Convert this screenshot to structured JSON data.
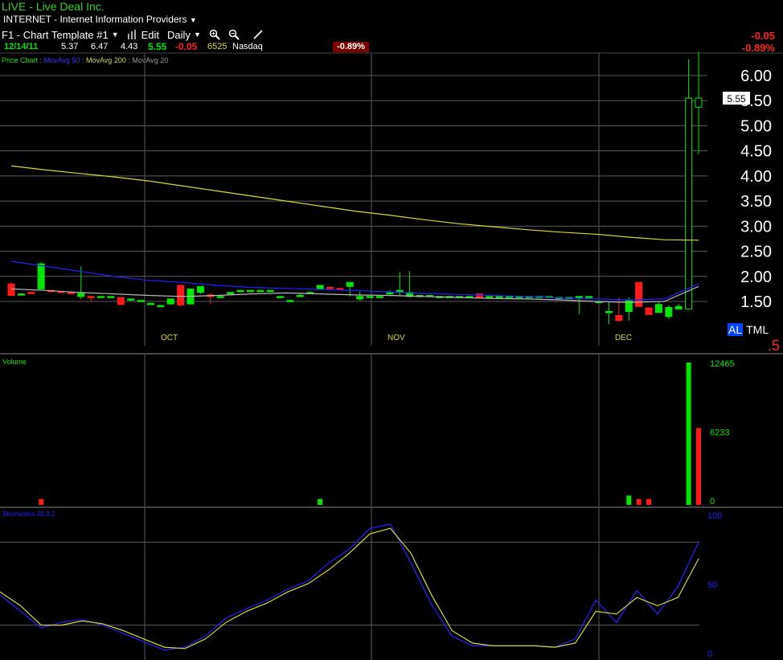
{
  "header": {
    "symbol": "LIVE",
    "separator": " - ",
    "company": "Live Deal Inc.",
    "sector_code": "INTERNET",
    "sector_name": "Internet Information Providers"
  },
  "toolbar": {
    "template_label": "F1 - Chart Template #1",
    "edit_label": "Edit",
    "period_label": "Daily"
  },
  "quote": {
    "date": "12/14/11",
    "open": "5.37",
    "high": "6.47",
    "low": "4.43",
    "close": "5.55",
    "change": "-0.05",
    "volume": "6525",
    "exchange": "Nasdaq",
    "pct_change": "-0.89%",
    "change_top": "-0.05",
    "pct_top": "-0.89%"
  },
  "indicators": {
    "price_chart": "Price Chart",
    "ma50": "MovAvg 50",
    "ma200": "MovAvg 200",
    "ma20": "MovAvg 20",
    "volume": "Volume",
    "stochastics": "Stochastics 20,3,2"
  },
  "side_tabs": {
    "tab1": "AL",
    "tab2": "TML",
    "partial": ".5"
  },
  "colors": {
    "up": "#00e600",
    "down": "#ff1a1a",
    "ma50": "#2222ff",
    "ma200": "#d8d830",
    "ma20": "#b8b8b8",
    "grid": "#5a5a5a"
  },
  "chart_data": [
    {
      "type": "candlestick",
      "title": "Price Chart",
      "y_ticks": [
        "1.50",
        "2.00",
        "2.50",
        "3.00",
        "3.50",
        "4.00",
        "4.50",
        "5.00",
        "5.50",
        "6.00"
      ],
      "ylim": [
        1.0,
        6.3
      ],
      "x_labels": [
        "OCT",
        "NOV",
        "DEC"
      ],
      "last_price_label": "5.55",
      "series": [
        {
          "name": "MovAvg 200",
          "values": [
            4.2,
            4.12,
            4.05,
            3.98,
            3.9,
            3.8,
            3.7,
            3.6,
            3.5,
            3.4,
            3.3,
            3.22,
            3.13,
            3.05,
            2.99,
            2.93,
            2.88,
            2.84,
            2.78,
            2.73,
            2.72
          ]
        },
        {
          "name": "MovAvg 50",
          "values": [
            2.3,
            2.2,
            2.1,
            2.0,
            1.92,
            1.88,
            1.82,
            1.78,
            1.76,
            1.74,
            1.72,
            1.69,
            1.66,
            1.64,
            1.62,
            1.6,
            1.57,
            1.55,
            1.53,
            1.55,
            1.85
          ]
        },
        {
          "name": "MovAvg 20",
          "values": [
            1.75,
            1.72,
            1.68,
            1.65,
            1.62,
            1.6,
            1.62,
            1.65,
            1.67,
            1.65,
            1.63,
            1.62,
            1.6,
            1.58,
            1.56,
            1.55,
            1.53,
            1.5,
            1.48,
            1.5,
            1.8
          ]
        }
      ],
      "candles": [
        {
          "o": 1.85,
          "h": 1.88,
          "l": 1.62,
          "c": 1.62
        },
        {
          "o": 1.65,
          "h": 1.66,
          "l": 1.64,
          "c": 1.65
        },
        {
          "o": 1.68,
          "h": 1.7,
          "l": 1.66,
          "c": 1.67
        },
        {
          "o": 1.75,
          "h": 2.28,
          "l": 1.72,
          "c": 2.25
        },
        {
          "o": 1.72,
          "h": 1.72,
          "l": 1.68,
          "c": 1.7
        },
        {
          "o": 1.7,
          "h": 1.7,
          "l": 1.66,
          "c": 1.68
        },
        {
          "o": 1.68,
          "h": 1.7,
          "l": 1.64,
          "c": 1.66
        },
        {
          "o": 1.6,
          "h": 2.2,
          "l": 1.55,
          "c": 1.66
        },
        {
          "o": 1.6,
          "h": 1.62,
          "l": 1.5,
          "c": 1.58
        },
        {
          "o": 1.6,
          "h": 1.6,
          "l": 1.58,
          "c": 1.6
        },
        {
          "o": 1.6,
          "h": 1.6,
          "l": 1.58,
          "c": 1.6
        },
        {
          "o": 1.58,
          "h": 1.58,
          "l": 1.44,
          "c": 1.44
        },
        {
          "o": 1.53,
          "h": 1.56,
          "l": 1.5,
          "c": 1.55
        },
        {
          "o": 1.52,
          "h": 1.53,
          "l": 1.5,
          "c": 1.52
        },
        {
          "o": 1.45,
          "h": 1.48,
          "l": 1.45,
          "c": 1.46
        },
        {
          "o": 1.42,
          "h": 1.43,
          "l": 1.4,
          "c": 1.42
        },
        {
          "o": 1.45,
          "h": 1.48,
          "l": 1.45,
          "c": 1.55
        },
        {
          "o": 1.82,
          "h": 1.84,
          "l": 1.4,
          "c": 1.43
        },
        {
          "o": 1.45,
          "h": 1.75,
          "l": 1.45,
          "c": 1.75
        },
        {
          "o": 1.68,
          "h": 1.8,
          "l": 1.65,
          "c": 1.8
        },
        {
          "o": 1.63,
          "h": 1.67,
          "l": 1.45,
          "c": 1.6
        },
        {
          "o": 1.6,
          "h": 1.62,
          "l": 1.58,
          "c": 1.6
        },
        {
          "o": 1.65,
          "h": 1.68,
          "l": 1.63,
          "c": 1.68
        },
        {
          "o": 1.7,
          "h": 1.72,
          "l": 1.68,
          "c": 1.72
        },
        {
          "o": 1.72,
          "h": 1.72,
          "l": 1.72,
          "c": 1.72
        },
        {
          "o": 1.72,
          "h": 1.72,
          "l": 1.72,
          "c": 1.72
        },
        {
          "o": 1.72,
          "h": 1.72,
          "l": 1.72,
          "c": 1.72
        },
        {
          "o": 1.6,
          "h": 1.6,
          "l": 1.58,
          "c": 1.6
        },
        {
          "o": 1.52,
          "h": 1.53,
          "l": 1.5,
          "c": 1.52
        },
        {
          "o": 1.62,
          "h": 1.65,
          "l": 1.6,
          "c": 1.62
        },
        {
          "o": 1.68,
          "h": 1.7,
          "l": 1.65,
          "c": 1.68
        },
        {
          "o": 1.75,
          "h": 1.82,
          "l": 1.73,
          "c": 1.82
        },
        {
          "o": 1.78,
          "h": 1.8,
          "l": 1.76,
          "c": 1.77
        },
        {
          "o": 1.76,
          "h": 1.76,
          "l": 1.74,
          "c": 1.75
        },
        {
          "o": 1.8,
          "h": 1.88,
          "l": 1.6,
          "c": 1.88
        },
        {
          "o": 1.55,
          "h": 1.7,
          "l": 1.52,
          "c": 1.6
        },
        {
          "o": 1.6,
          "h": 1.6,
          "l": 1.58,
          "c": 1.6
        },
        {
          "o": 1.6,
          "h": 1.6,
          "l": 1.58,
          "c": 1.6
        },
        {
          "o": 1.65,
          "h": 1.72,
          "l": 1.6,
          "c": 1.68
        },
        {
          "o": 1.68,
          "h": 2.08,
          "l": 1.62,
          "c": 1.72
        },
        {
          "o": 1.6,
          "h": 2.1,
          "l": 1.58,
          "c": 1.68
        },
        {
          "o": 1.62,
          "h": 1.62,
          "l": 1.6,
          "c": 1.62
        },
        {
          "o": 1.62,
          "h": 1.62,
          "l": 1.6,
          "c": 1.62
        },
        {
          "o": 1.6,
          "h": 1.6,
          "l": 1.6,
          "c": 1.6
        },
        {
          "o": 1.6,
          "h": 1.6,
          "l": 1.6,
          "c": 1.6
        },
        {
          "o": 1.6,
          "h": 1.6,
          "l": 1.6,
          "c": 1.6
        },
        {
          "o": 1.6,
          "h": 1.6,
          "l": 1.6,
          "c": 1.6
        },
        {
          "o": 1.65,
          "h": 1.65,
          "l": 1.58,
          "c": 1.58
        },
        {
          "o": 1.6,
          "h": 1.6,
          "l": 1.6,
          "c": 1.6
        },
        {
          "o": 1.6,
          "h": 1.6,
          "l": 1.6,
          "c": 1.6
        },
        {
          "o": 1.6,
          "h": 1.6,
          "l": 1.6,
          "c": 1.6
        },
        {
          "o": 1.6,
          "h": 1.6,
          "l": 1.6,
          "c": 1.6
        },
        {
          "o": 1.6,
          "h": 1.6,
          "l": 1.6,
          "c": 1.6
        },
        {
          "o": 1.6,
          "h": 1.6,
          "l": 1.6,
          "c": 1.6
        },
        {
          "o": 1.6,
          "h": 1.6,
          "l": 1.6,
          "c": 1.6
        },
        {
          "o": 1.58,
          "h": 1.58,
          "l": 1.58,
          "c": 1.58
        },
        {
          "o": 1.58,
          "h": 1.58,
          "l": 1.58,
          "c": 1.58
        },
        {
          "o": 1.6,
          "h": 1.6,
          "l": 1.25,
          "c": 1.6
        },
        {
          "o": 1.6,
          "h": 1.6,
          "l": 1.6,
          "c": 1.6
        },
        {
          "o": 1.5,
          "h": 1.5,
          "l": 1.48,
          "c": 1.5
        },
        {
          "o": 1.3,
          "h": 1.48,
          "l": 1.05,
          "c": 1.3
        },
        {
          "o": 1.22,
          "h": 1.58,
          "l": 1.1,
          "c": 1.12
        },
        {
          "o": 1.3,
          "h": 1.58,
          "l": 1.12,
          "c": 1.52
        },
        {
          "o": 1.88,
          "h": 1.88,
          "l": 1.4,
          "c": 1.4
        },
        {
          "o": 1.37,
          "h": 1.37,
          "l": 1.24,
          "c": 1.24
        },
        {
          "o": 1.28,
          "h": 1.48,
          "l": 1.28,
          "c": 1.44
        },
        {
          "o": 1.2,
          "h": 1.42,
          "l": 1.15,
          "c": 1.38
        },
        {
          "o": 1.35,
          "h": 1.45,
          "l": 1.35,
          "c": 1.4
        },
        {
          "o": 1.35,
          "h": 6.32,
          "l": 1.35,
          "c": 5.55
        },
        {
          "o": 5.37,
          "h": 6.47,
          "l": 4.43,
          "c": 5.55
        }
      ]
    },
    {
      "type": "bar",
      "title": "Volume",
      "y_ticks": [
        "0",
        "6233",
        "12465"
      ],
      "ylim": [
        0,
        12465
      ],
      "values": [
        {
          "i": 3,
          "v": 90,
          "up": false
        },
        {
          "i": 31,
          "v": 100,
          "up": true
        },
        {
          "i": 62,
          "v": 400,
          "up": true
        },
        {
          "i": 63,
          "v": 90,
          "up": false
        },
        {
          "i": 64,
          "v": 90,
          "up": false
        },
        {
          "i": 68,
          "v": 12465,
          "up": true
        },
        {
          "i": 69,
          "v": 6525,
          "up": false
        }
      ]
    },
    {
      "type": "line",
      "title": "Stochastics 20,3,2",
      "y_ticks": [
        "0",
        "50",
        "100"
      ],
      "ylim": [
        0,
        100
      ],
      "series": [
        {
          "name": "%K",
          "values": [
            42,
            30,
            18,
            22,
            24,
            20,
            14,
            8,
            2,
            4,
            12,
            25,
            32,
            38,
            46,
            52,
            65,
            75,
            90,
            93,
            65,
            35,
            12,
            5,
            5,
            5,
            5,
            4,
            10,
            38,
            22,
            45,
            28,
            48,
            80
          ]
        },
        {
          "name": "%D",
          "values": [
            44,
            34,
            20,
            20,
            23,
            21,
            16,
            10,
            4,
            3,
            10,
            22,
            30,
            36,
            44,
            50,
            60,
            72,
            86,
            90,
            72,
            42,
            16,
            7,
            5,
            5,
            5,
            4,
            7,
            30,
            28,
            40,
            34,
            40,
            68
          ]
        }
      ]
    }
  ]
}
